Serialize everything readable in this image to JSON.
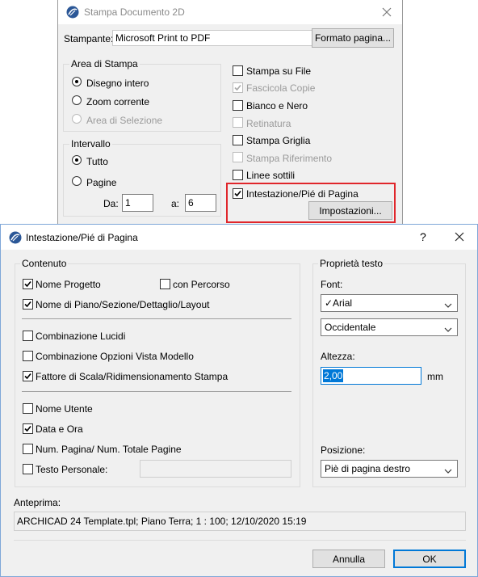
{
  "bg_dialog": {
    "title": "Stampa Documento 2D",
    "printer_label": "Stampante:",
    "printer_value": "Microsoft Print to PDF",
    "page_format_button": "Formato pagina...",
    "print_area": {
      "legend": "Area di Stampa",
      "options": [
        "Disegno intero",
        "Zoom corrente",
        "Area di Selezione"
      ],
      "selected": "Disegno intero"
    },
    "range": {
      "legend": "Intervallo",
      "options": [
        "Tutto",
        "Pagine"
      ],
      "selected": "Tutto",
      "from_label": "Da:",
      "from_value": "1",
      "to_label": "a:",
      "to_value": "6"
    },
    "checks": [
      {
        "label": "Stampa su File",
        "checked": false,
        "enabled": true
      },
      {
        "label": "Fascicola Copie",
        "checked": true,
        "enabled": false
      },
      {
        "label": "Bianco e Nero",
        "checked": false,
        "enabled": true
      },
      {
        "label": "Retinatura",
        "checked": false,
        "enabled": false
      },
      {
        "label": "Stampa Griglia",
        "checked": false,
        "enabled": true
      },
      {
        "label": "Stampa Riferimento",
        "checked": false,
        "enabled": false
      },
      {
        "label": "Linee sottili",
        "checked": false,
        "enabled": true
      },
      {
        "label": "Intestazione/Pié di Pagina",
        "checked": true,
        "enabled": true
      }
    ],
    "settings_button": "Impostazioni...",
    "highlight_color": "#e0262b"
  },
  "fg_dialog": {
    "title": "Intestazione/Pié di Pagina",
    "help": "?",
    "content_group": {
      "legend": "Contenuto",
      "items": [
        {
          "label": "Nome Progetto",
          "checked": true
        },
        {
          "label": "con Percorso",
          "checked": false
        },
        {
          "label": "Nome di Piano/Sezione/Dettaglio/Layout",
          "checked": true
        },
        {
          "label": "Combinazione Lucidi",
          "checked": false
        },
        {
          "label": "Combinazione Opzioni Vista Modello",
          "checked": false
        },
        {
          "label": "Fattore di Scala/Ridimensionamento Stampa",
          "checked": true
        },
        {
          "label": "Nome Utente",
          "checked": false
        },
        {
          "label": "Data e Ora",
          "checked": true
        },
        {
          "label": "Num. Pagina/ Num. Totale Pagine",
          "checked": false
        },
        {
          "label": "Testo Personale:",
          "checked": false
        }
      ],
      "custom_text_value": ""
    },
    "text_props": {
      "legend": "Proprietà testo",
      "font_label": "Font:",
      "font_value": "✓Arial",
      "script_value": "Occidentale",
      "height_label": "Altezza:",
      "height_value": "2,00",
      "height_unit": "mm",
      "position_label": "Posizione:",
      "position_value": "Piè di pagina destro"
    },
    "preview_label": "Anteprima:",
    "preview_text": "ARCHICAD 24 Template.tpl; Piano Terra; 1 : 100; 12/10/2020 15:19",
    "cancel_button": "Annulla",
    "ok_button": "OK",
    "accent_color": "#0078d7"
  }
}
